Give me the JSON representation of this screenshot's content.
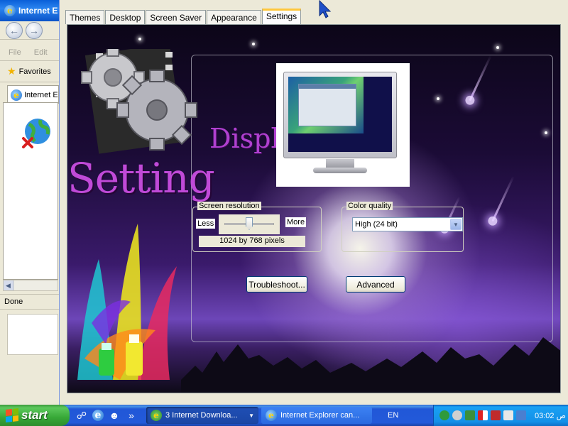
{
  "ie_window": {
    "title": "Internet E",
    "menu": [
      "File",
      "Edit"
    ],
    "favorites_label": "Favorites",
    "tab_label": "Internet E",
    "status": "Done"
  },
  "dialog": {
    "tabs": [
      "Themes",
      "Desktop",
      "Screen Saver",
      "Appearance",
      "Settings"
    ],
    "active_tab": "Settings",
    "wallpaper_text": {
      "display": "Displ",
      "setting": "Setting"
    },
    "resolution": {
      "legend": "Screen resolution",
      "less_label": "Less",
      "more_label": "More",
      "value": "1024 by 768 pixels",
      "slider_fraction": 0.5
    },
    "color_quality": {
      "legend": "Color quality",
      "selected": "High (24 bit)"
    },
    "buttons": {
      "troubleshoot": "Troubleshoot...",
      "advanced": "Advanced"
    }
  },
  "taskbar": {
    "start_label": "start",
    "tasks": [
      {
        "label": "3 Internet Downloa..."
      },
      {
        "label": "Internet Explorer can..."
      }
    ],
    "language": "EN",
    "clock": "03:02 ص"
  },
  "colors": {
    "xp_blue": "#2157d7",
    "start_green": "#37a837",
    "setting_text": "#c04ad8"
  }
}
